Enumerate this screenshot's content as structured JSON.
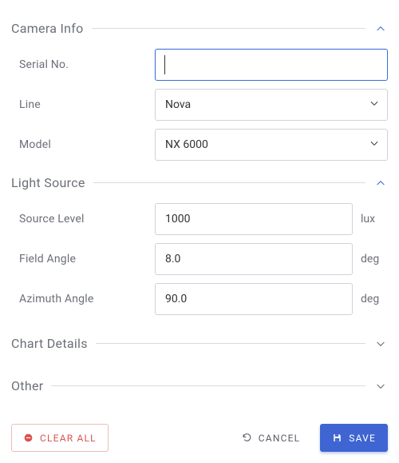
{
  "sections": {
    "camera": {
      "title": "Camera Info",
      "serial_label": "Serial No.",
      "serial_value": "",
      "line_label": "Line",
      "line_value": "Nova",
      "model_label": "Model",
      "model_value": "NX 6000"
    },
    "light": {
      "title": "Light Source",
      "level_label": "Source Level",
      "level_value": "1000",
      "level_unit": "lux",
      "field_label": "Field Angle",
      "field_value": "8.0",
      "field_unit": "deg",
      "azimuth_label": "Azimuth Angle",
      "azimuth_value": "90.0",
      "azimuth_unit": "deg"
    },
    "chart": {
      "title": "Chart Details"
    },
    "other": {
      "title": "Other"
    }
  },
  "footer": {
    "clear_label": "CLEAR ALL",
    "cancel_label": "CANCEL",
    "save_label": "SAVE"
  }
}
